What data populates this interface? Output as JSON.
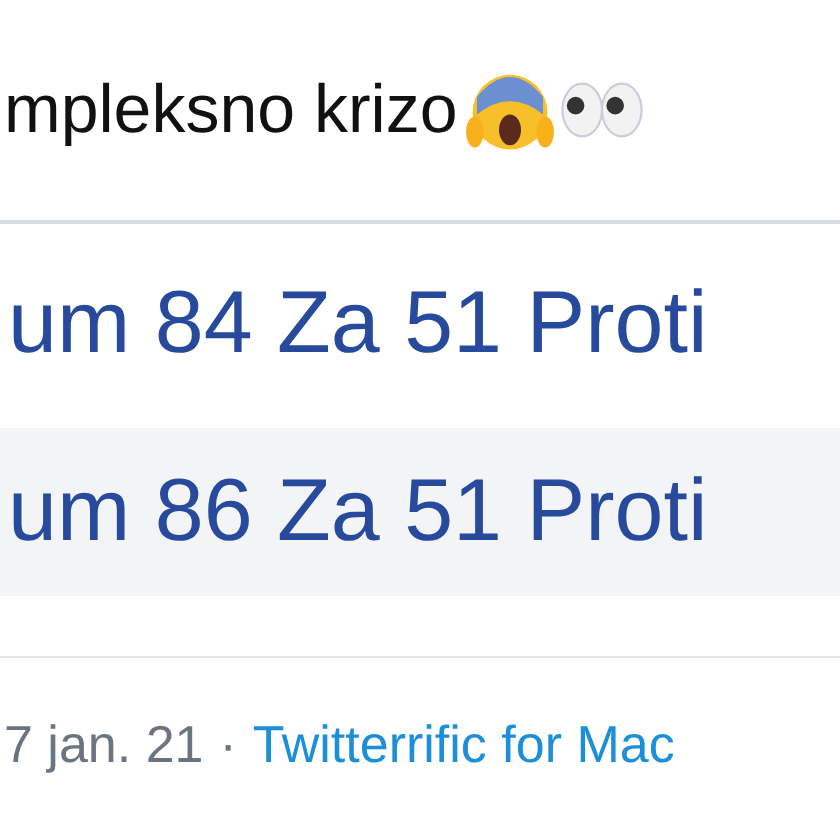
{
  "tweet": {
    "text": "mpleksno krizo",
    "emojis": [
      {
        "kind": "scream"
      },
      {
        "kind": "eyes"
      }
    ]
  },
  "embedded_table": {
    "rows": [
      {
        "text": "um 84 Za 51 Proti",
        "shaded": false
      },
      {
        "text": "um 86 Za 51 Proti",
        "shaded": true
      }
    ]
  },
  "meta": {
    "date": "7 jan. 21",
    "separator": "·",
    "source": "Twitterrific for Mac"
  }
}
